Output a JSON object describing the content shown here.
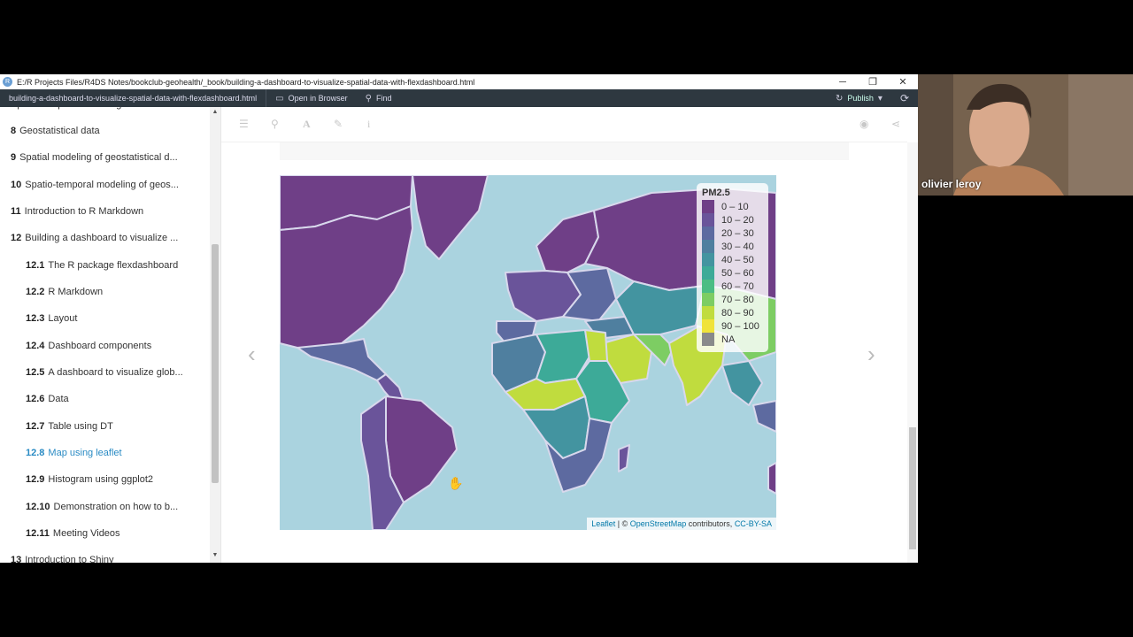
{
  "window": {
    "title": "E:/R Projects Files/R4DS Notes/bookclub-geohealth/_book/building-a-dashboard-to-visualize-spatial-data-with-flexdashboard.html",
    "controls": {
      "minimize": "─",
      "restore": "❐",
      "close": "✕"
    }
  },
  "toolbar": {
    "file_tab": "building-a-dashboard-to-visualize-spatial-data-with-flexdashboard.html",
    "open_in_browser": "Open in Browser",
    "find": "Find",
    "publish": "Publish"
  },
  "sidebar": {
    "items": [
      {
        "num": "",
        "label": "Spatio-temporal modeling of areal...",
        "sub": false,
        "active": false
      },
      {
        "num": "8",
        "label": "Geostatistical data",
        "sub": false,
        "active": false
      },
      {
        "num": "9",
        "label": "Spatial modeling of geostatistical d...",
        "sub": false,
        "active": false
      },
      {
        "num": "10",
        "label": "Spatio-temporal modeling of geos...",
        "sub": false,
        "active": false
      },
      {
        "num": "11",
        "label": "Introduction to R Markdown",
        "sub": false,
        "active": false
      },
      {
        "num": "12",
        "label": "Building a dashboard to visualize ...",
        "sub": false,
        "active": false
      },
      {
        "num": "12.1",
        "label": "The R package flexdashboard",
        "sub": true,
        "active": false
      },
      {
        "num": "12.2",
        "label": "R Markdown",
        "sub": true,
        "active": false
      },
      {
        "num": "12.3",
        "label": "Layout",
        "sub": true,
        "active": false
      },
      {
        "num": "12.4",
        "label": "Dashboard components",
        "sub": true,
        "active": false
      },
      {
        "num": "12.5",
        "label": "A dashboard to visualize glob...",
        "sub": true,
        "active": false
      },
      {
        "num": "12.6",
        "label": "Data",
        "sub": true,
        "active": false
      },
      {
        "num": "12.7",
        "label": "Table using DT",
        "sub": true,
        "active": false
      },
      {
        "num": "12.8",
        "label": "Map using leaflet",
        "sub": true,
        "active": true
      },
      {
        "num": "12.9",
        "label": "Histogram using ggplot2",
        "sub": true,
        "active": false
      },
      {
        "num": "12.10",
        "label": "Demonstration on how to b...",
        "sub": true,
        "active": false
      },
      {
        "num": "12.11",
        "label": "Meeting Videos",
        "sub": true,
        "active": false
      },
      {
        "num": "13",
        "label": "Introduction to Shiny",
        "sub": false,
        "active": false
      }
    ]
  },
  "book_toolbar": {
    "icons": [
      "menu-icon",
      "search-icon",
      "font-icon",
      "edit-icon",
      "info-icon",
      "github-icon",
      "share-icon"
    ]
  },
  "map": {
    "legend": {
      "title": "PM2.5",
      "entries": [
        {
          "label": "0 – 10",
          "color": "#6f3f87"
        },
        {
          "label": "10 – 20",
          "color": "#6a549a"
        },
        {
          "label": "20 – 30",
          "color": "#5d6aa0"
        },
        {
          "label": "30 – 40",
          "color": "#4f7f9f"
        },
        {
          "label": "40 – 50",
          "color": "#4394a0"
        },
        {
          "label": "50 – 60",
          "color": "#3daa98"
        },
        {
          "label": "60 – 70",
          "color": "#4cbd84"
        },
        {
          "label": "70 – 80",
          "color": "#7dcd63"
        },
        {
          "label": "80 – 90",
          "color": "#c0dc3e"
        },
        {
          "label": "90 – 100",
          "color": "#f0e33a"
        },
        {
          "label": "NA",
          "color": "#8a8a8a"
        }
      ]
    },
    "attribution": {
      "leaflet": "Leaflet",
      "separator": " | © ",
      "osm": "OpenStreetMap",
      "contributors": " contributors, ",
      "license": "CC-BY-SA"
    },
    "ocean_color": "#aad3df",
    "border_color": "#d8d8ec"
  },
  "webcam": {
    "name": "olivier leroy"
  }
}
